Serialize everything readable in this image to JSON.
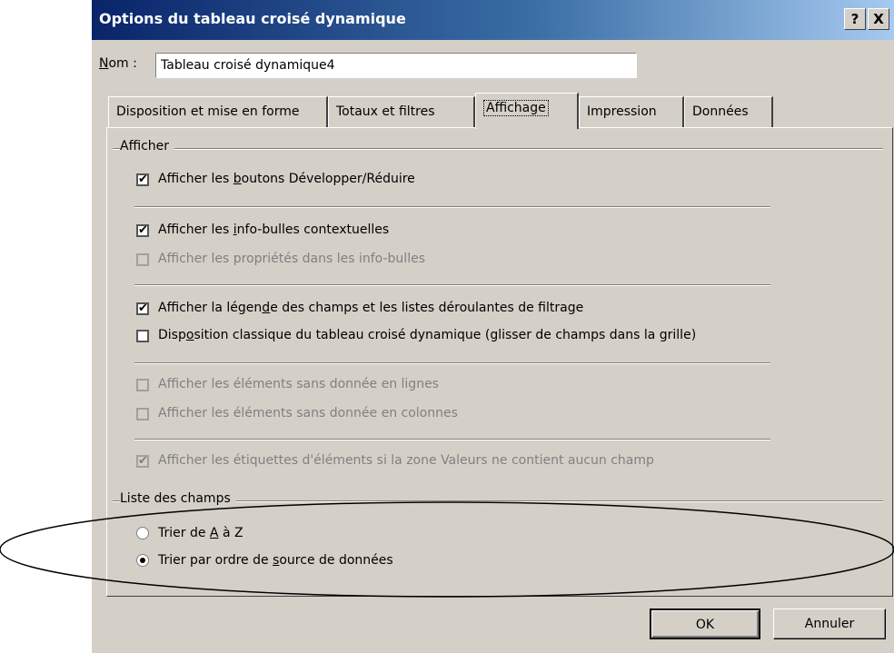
{
  "window": {
    "title": "Options du tableau croisé dynamique",
    "help_btn": "?",
    "close_btn": "X"
  },
  "name": {
    "label_prefix": "N",
    "label_rest": "om :",
    "value": "Tableau croisé dynamique4"
  },
  "tabs": [
    {
      "label": "Disposition et mise en forme",
      "active": false
    },
    {
      "label": "Totaux et filtres",
      "active": false
    },
    {
      "label": "Affichage",
      "active": true
    },
    {
      "label": "Impression",
      "active": false
    },
    {
      "label": "Données",
      "active": false
    }
  ],
  "afficher": {
    "group_label": "Afficher",
    "options": [
      {
        "pre": "Afficher les ",
        "mn": "b",
        "post": "outons Développer/Réduire",
        "checked": true,
        "enabled": true
      },
      {
        "pre": "Afficher les ",
        "mn": "i",
        "post": "nfo-bulles contextuelles",
        "checked": true,
        "enabled": true
      },
      {
        "pre": "Afficher les propriétés dans les info-bulles",
        "mn": "",
        "post": "",
        "checked": false,
        "enabled": false
      },
      {
        "pre": "Afficher la légen",
        "mn": "d",
        "post": "e des champs et les listes déroulantes de filtrage",
        "checked": true,
        "enabled": true
      },
      {
        "pre": "Disp",
        "mn": "o",
        "post": "sition classique du tableau croisé dynamique (glisser de champs dans la grille)",
        "checked": false,
        "enabled": true
      },
      {
        "pre": "Afficher les éléments sans donnée en lignes",
        "mn": "",
        "post": "",
        "checked": false,
        "enabled": false
      },
      {
        "pre": "Afficher les éléments sans donnée en colonnes",
        "mn": "",
        "post": "",
        "checked": false,
        "enabled": false
      },
      {
        "pre": "Afficher les étiquettes d'éléments si la zone Valeurs ne contient aucun champ",
        "mn": "",
        "post": "",
        "checked": true,
        "enabled": false
      }
    ]
  },
  "liste": {
    "group_label": "Liste des champs",
    "options": [
      {
        "pre": "Trier de ",
        "mn": "A",
        "post": " à Z",
        "selected": false
      },
      {
        "pre": "Trier par ordre de ",
        "mn": "s",
        "post": "ource de données",
        "selected": true
      }
    ]
  },
  "buttons": {
    "ok": "OK",
    "cancel": "Annuler"
  },
  "check_glyph": "✔"
}
